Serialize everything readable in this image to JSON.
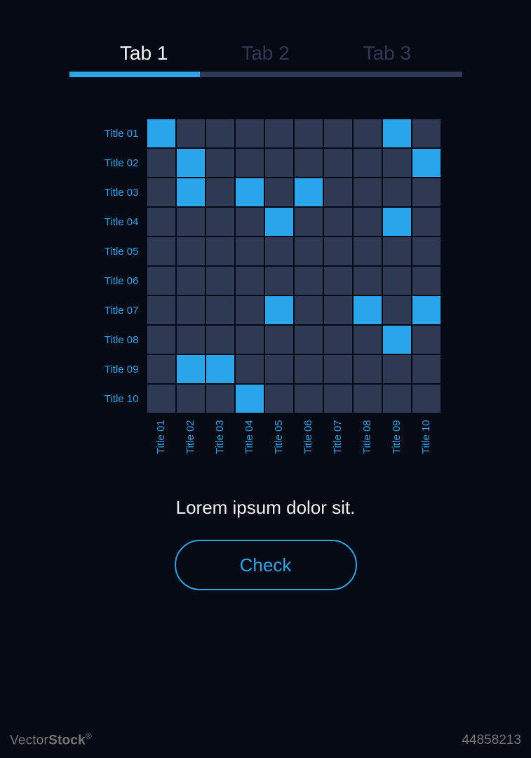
{
  "tabs": [
    "Tab 1",
    "Tab 2",
    "Tab 3"
  ],
  "active_tab": 0,
  "caption": "Lorem ipsum dolor sit.",
  "button_label": "Check",
  "watermark_left": "VectorStock",
  "watermark_sup": "®",
  "image_id": "44858213",
  "chart_data": {
    "type": "heatmap",
    "row_labels": [
      "Title 01",
      "Title 02",
      "Title 03",
      "Title 04",
      "Title 05",
      "Title 06",
      "Title 07",
      "Title 08",
      "Title 09",
      "Title 10"
    ],
    "col_labels": [
      "Title 01",
      "Title 02",
      "Title 03",
      "Title 04",
      "Title 05",
      "Title 06",
      "Title 07",
      "Title 08",
      "Title 09",
      "Title 10"
    ],
    "values": [
      [
        1,
        0,
        0,
        0,
        0,
        0,
        0,
        0,
        1,
        0
      ],
      [
        0,
        1,
        0,
        0,
        0,
        0,
        0,
        0,
        0,
        1
      ],
      [
        0,
        1,
        0,
        1,
        0,
        1,
        0,
        0,
        0,
        0
      ],
      [
        0,
        0,
        0,
        0,
        1,
        0,
        0,
        0,
        1,
        0
      ],
      [
        0,
        0,
        0,
        0,
        0,
        0,
        0,
        0,
        0,
        0
      ],
      [
        0,
        0,
        0,
        0,
        0,
        0,
        0,
        0,
        0,
        0
      ],
      [
        0,
        0,
        0,
        0,
        1,
        0,
        0,
        1,
        0,
        1
      ],
      [
        0,
        0,
        0,
        0,
        0,
        0,
        0,
        0,
        1,
        0
      ],
      [
        0,
        1,
        1,
        0,
        0,
        0,
        0,
        0,
        0,
        0
      ],
      [
        0,
        0,
        0,
        1,
        0,
        0,
        0,
        0,
        0,
        0
      ]
    ]
  }
}
